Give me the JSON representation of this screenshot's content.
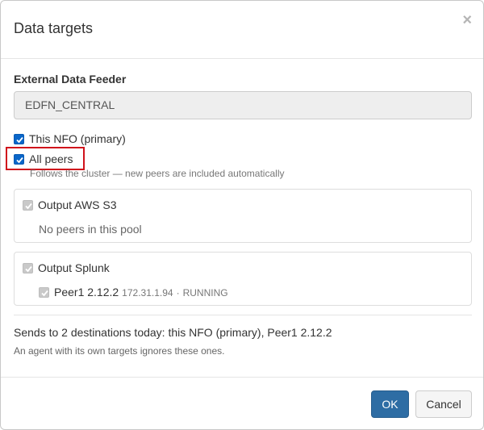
{
  "dialog": {
    "title": "Data targets",
    "close_glyph": "×"
  },
  "feeder": {
    "label": "External Data Feeder",
    "value": "EDFN_CENTRAL"
  },
  "options": {
    "this_nfo": {
      "label": "This NFO (primary)",
      "checked": true
    },
    "all_peers": {
      "label": "All peers",
      "checked": true,
      "hint": "Follows the cluster — new peers are included automatically"
    }
  },
  "groups": [
    {
      "title": "Output AWS S3",
      "checked": true,
      "disabled": true,
      "empty_text": "No peers in this pool"
    },
    {
      "title": "Output Splunk",
      "checked": true,
      "disabled": true,
      "peers": [
        {
          "name": "Peer1 2.12.2",
          "ip": "172.31.1.94",
          "separator": "·",
          "status": "RUNNING",
          "checked": true,
          "disabled": true
        }
      ]
    }
  ],
  "summary": {
    "text": "Sends to 2 destinations today: this NFO (primary), Peer1 2.12.2",
    "note": "An agent with its own targets ignores these ones."
  },
  "footer": {
    "ok_label": "OK",
    "cancel_label": "Cancel"
  },
  "colors": {
    "checkbox_checked": "#0a66c9",
    "checkbox_disabled": "#c9c9c9",
    "primary_button": "#2e6da4",
    "highlight_border": "#d0121b"
  }
}
